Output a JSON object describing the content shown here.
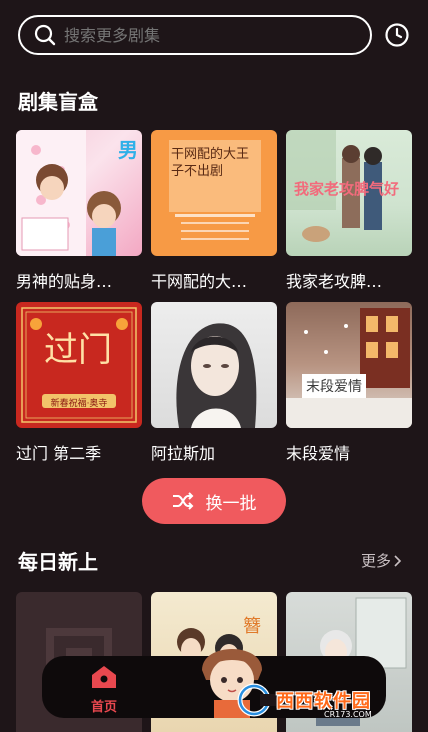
{
  "search": {
    "placeholder": "搜索更多剧集"
  },
  "blind_box": {
    "title": "剧集盲盒",
    "items": [
      {
        "title": "男神的贴身…",
        "cover_text": "男"
      },
      {
        "title": "干网配的大…",
        "cover_text": "干网配的大王子不出剧"
      },
      {
        "title": "我家老攻脾…",
        "cover_text": "我家老攻脾气好"
      },
      {
        "title": "过门 第二季",
        "cover_text": "过门",
        "cover_subtext": "新春祝福·奥寺"
      },
      {
        "title": "阿拉斯加",
        "cover_text": ""
      },
      {
        "title": "末段爱情",
        "cover_text": "末段爱情"
      }
    ],
    "shuffle_label": "换一批"
  },
  "daily": {
    "title": "每日新上",
    "more_label": "更多"
  },
  "tabbar": {
    "home_label": "首页"
  },
  "watermark": {
    "text": "西西软件园",
    "sub": "CR173.COM"
  },
  "colors": {
    "background": "#1e1518",
    "accent": "#f05a5e",
    "tab_active": "#e8484f"
  }
}
